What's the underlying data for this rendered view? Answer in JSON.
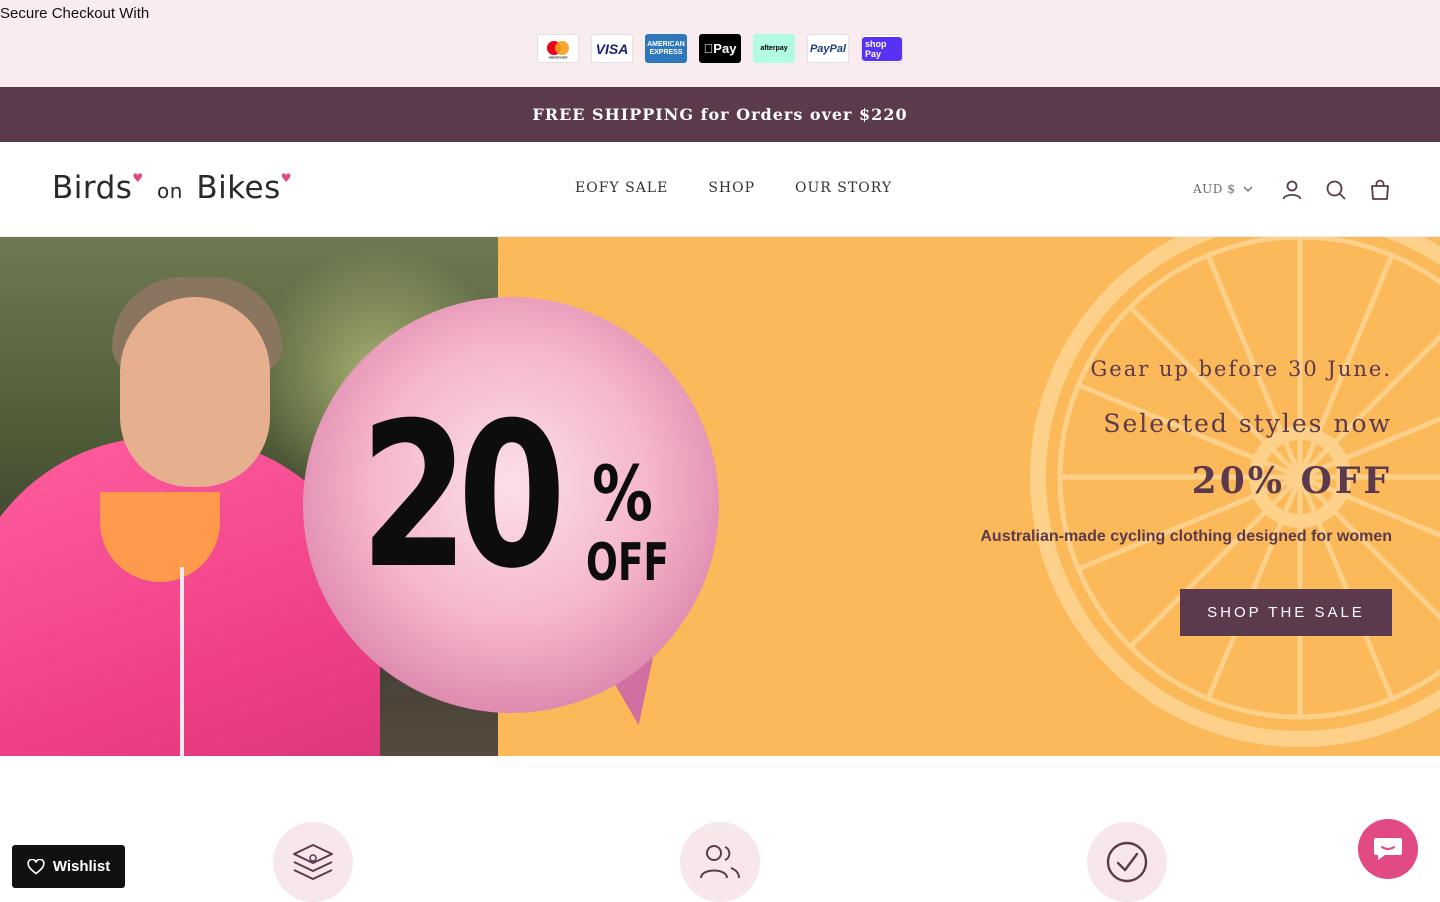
{
  "payment_bar": {
    "title": "Secure Checkout With",
    "methods": [
      {
        "icon": "mastercard-icon",
        "label": "mastercard"
      },
      {
        "icon": "visa-icon",
        "label": "VISA"
      },
      {
        "icon": "amex-icon",
        "label": "AMERICAN EXPRESS"
      },
      {
        "icon": "apple-pay-icon",
        "label": "Pay"
      },
      {
        "icon": "afterpay-icon",
        "label": "afterpay"
      },
      {
        "icon": "paypal-icon",
        "label": "PayPal"
      },
      {
        "icon": "shop-pay-icon",
        "label": "shop Pay"
      }
    ]
  },
  "announcement": {
    "text": "FREE SHIPPING for Orders over $220",
    "background": "#5c3a4e"
  },
  "header": {
    "logo": {
      "word1": "Birds",
      "word2": "on",
      "word3": "Bikes"
    },
    "nav": [
      "EOFY SALE",
      "SHOP",
      "OUR STORY"
    ],
    "currency": "AUD $",
    "icons": [
      "account-icon",
      "search-icon",
      "cart-icon"
    ]
  },
  "hero": {
    "badge": {
      "number": "20",
      "percent": "%",
      "off": "OFF"
    },
    "line1": "Gear up before 30 June.",
    "line2": "Selected styles now",
    "line3": "20% OFF",
    "line4": "Australian-made cycling clothing designed for women",
    "cta": "SHOP THE SALE",
    "background": "#fbb95a"
  },
  "features": {
    "icons": [
      "layers-icon",
      "users-icon",
      "check-circle-icon"
    ]
  },
  "wishlist": {
    "label": "Wishlist",
    "icon": "heart-icon"
  },
  "chat": {
    "icon": "chat-icon"
  },
  "colors": {
    "brand": "#5c3a4e",
    "accent_pink": "#e24a86",
    "soft_pink": "#f8ecee"
  }
}
